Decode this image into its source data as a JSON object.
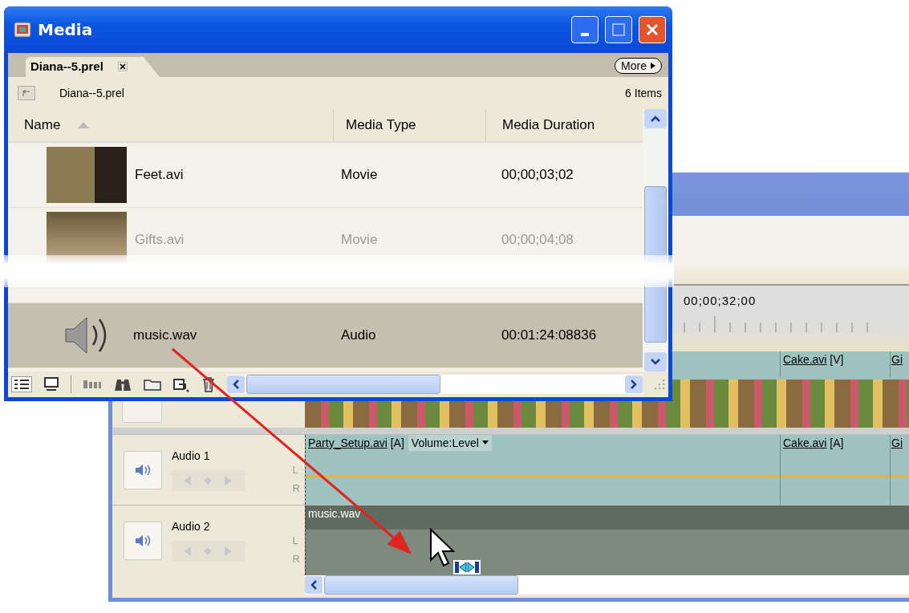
{
  "media_window": {
    "title": "Media",
    "tab": {
      "label": "Diana--5.prel",
      "selected": true
    },
    "more_button": "More",
    "path": "Diana--5.prel",
    "item_count": "6 Items",
    "columns": [
      {
        "label": "Name",
        "sorted": true
      },
      {
        "label": "Media Type",
        "sorted": false
      },
      {
        "label": "Media Duration",
        "sorted": false
      }
    ],
    "rows": [
      {
        "kind": "video",
        "name": "Feet.avi",
        "type": "Movie",
        "duration": "00;00;03;02",
        "selected": false
      },
      {
        "kind": "video",
        "name": "Gifts.avi",
        "type": "Movie",
        "duration": "00;00;04;08",
        "selected": false
      },
      {
        "kind": "audio",
        "name": "music.wav",
        "type": "Audio",
        "duration": "00:01:24:08836",
        "selected": true
      }
    ]
  },
  "timeline": {
    "ruler_time": "00;00;32;00",
    "video_clips": [
      {
        "name": "Cake.avi",
        "tag": "[V]"
      },
      {
        "name": "Gi"
      }
    ],
    "audio_tracks": [
      {
        "name": "Audio 1",
        "channels": [
          "L",
          "R"
        ],
        "kind": "filled",
        "clips": [
          {
            "name": "Party_Setup.avi",
            "tag": "[A]",
            "dropdown": "Volume:Level"
          },
          {
            "name": "Cake.avi",
            "tag": "[A]"
          },
          {
            "name": "Gi"
          }
        ]
      },
      {
        "name": "Audio 2",
        "channels": [
          "L",
          "R"
        ],
        "kind": "target",
        "clips": [
          {
            "name": "music.wav"
          }
        ]
      }
    ]
  }
}
